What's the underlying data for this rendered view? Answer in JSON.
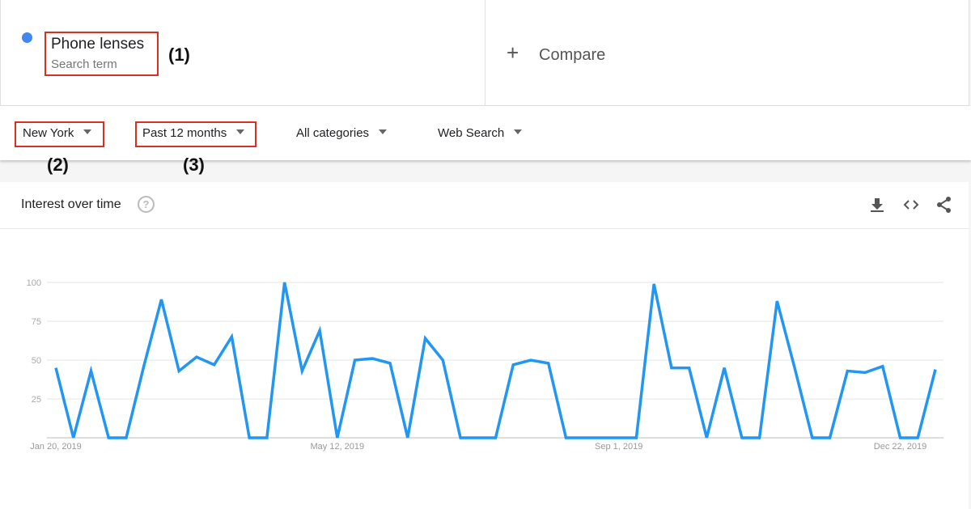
{
  "search_term": {
    "name": "Phone lenses",
    "type": "Search term",
    "color": "#4285f4",
    "annotation": "(1)"
  },
  "compare": {
    "label": "Compare",
    "icon": "plus-icon"
  },
  "filters": {
    "region": "New York",
    "region_annotation": "(2)",
    "time": "Past 12 months",
    "time_annotation": "(3)",
    "category": "All categories",
    "search_type": "Web Search"
  },
  "highlight_color": "#d93025",
  "card": {
    "title": "Interest over time",
    "help_icon": "?",
    "actions": [
      "download-icon",
      "embed-icon",
      "share-icon"
    ]
  },
  "chart_data": {
    "type": "line",
    "title": "",
    "xlabel": "",
    "ylabel": "",
    "ylim": [
      0,
      100
    ],
    "yticks": [
      "25",
      "50",
      "75",
      "100"
    ],
    "xtick_labels": [
      "Jan 20, 2019",
      "May 12, 2019",
      "Sep 1, 2019",
      "Dec 22, 2019"
    ],
    "xtick_indices": [
      0,
      16,
      32,
      48
    ],
    "grid": true,
    "line_color": "#2196f3",
    "series": [
      {
        "values": [
          45,
          0,
          43,
          0,
          0,
          46,
          89,
          43,
          52,
          47,
          65,
          0,
          0,
          100,
          43,
          69,
          0,
          50,
          51,
          48,
          0,
          64,
          50,
          0,
          0,
          0,
          47,
          50,
          48,
          0,
          0,
          0,
          0,
          0,
          99,
          45,
          45,
          0,
          45,
          0,
          0,
          88,
          45,
          0,
          0,
          43,
          42,
          46,
          0,
          0,
          44
        ]
      }
    ]
  }
}
